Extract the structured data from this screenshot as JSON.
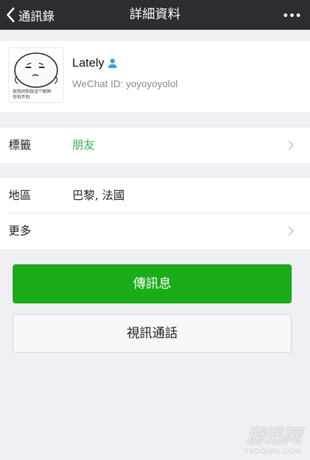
{
  "navbar": {
    "back_label": "通訊錄",
    "title": "詳細資料"
  },
  "profile": {
    "name": "Lately",
    "wechat_id": "WeChat ID: yoyoyoyolol",
    "avatar_caption_line1": "就我同你說沒个眼神",
    "avatar_caption_line2": "你怕不怕"
  },
  "tag_row": {
    "label": "標籤",
    "value": "朋友"
  },
  "region_row": {
    "label": "地區",
    "value": "巴黎, 法國"
  },
  "more_row": {
    "label": "更多"
  },
  "buttons": {
    "send_message": "傳訊息",
    "video_call": "視訊通話"
  },
  "watermark": {
    "main": "游迅网",
    "sub": "YXDOWN.COM"
  },
  "colors": {
    "navbar_bg": "#2d2d31",
    "page_bg": "#efeff4",
    "accent_green": "#1aad19",
    "tag_green": "#39b54a"
  }
}
